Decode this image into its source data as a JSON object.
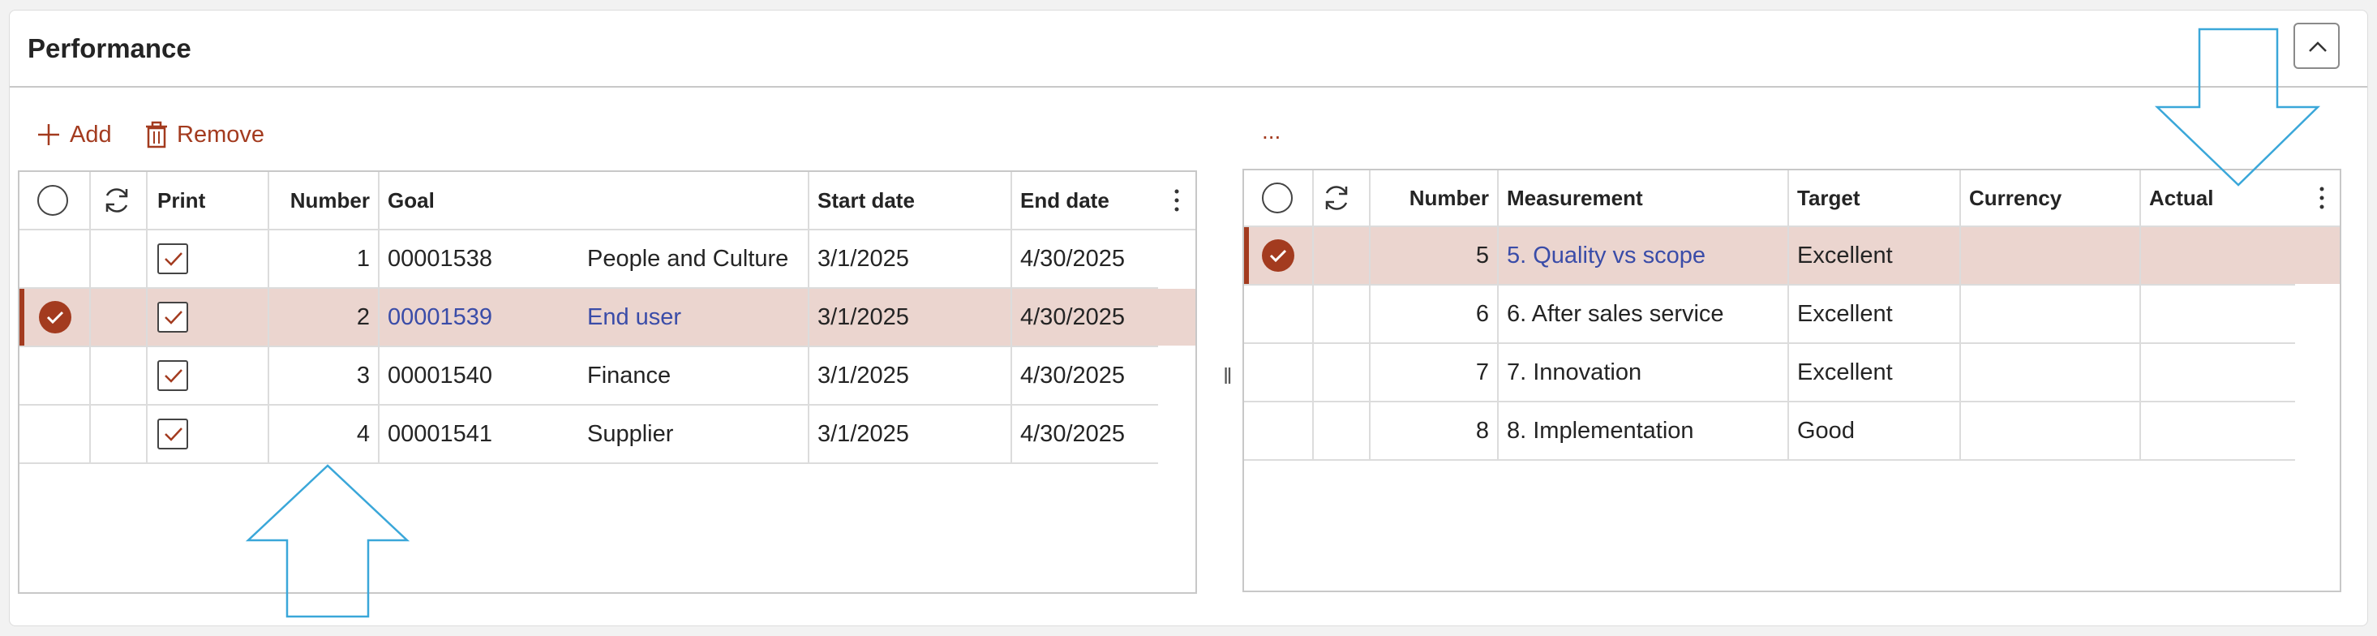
{
  "panel": {
    "title": "Performance"
  },
  "toolbar": {
    "add_label": "Add",
    "remove_label": "Remove",
    "more_label": "..."
  },
  "goals": {
    "headers": {
      "print": "Print",
      "number": "Number",
      "goal": "Goal",
      "start": "Start date",
      "end": "End date"
    },
    "rows": [
      {
        "number": "1",
        "goal_id": "00001538",
        "goal_name": "People and Culture",
        "start": "3/1/2025",
        "end": "4/30/2025",
        "print": true,
        "selected": false
      },
      {
        "number": "2",
        "goal_id": "00001539",
        "goal_name": "End user",
        "start": "3/1/2025",
        "end": "4/30/2025",
        "print": true,
        "selected": true
      },
      {
        "number": "3",
        "goal_id": "00001540",
        "goal_name": "Finance",
        "start": "3/1/2025",
        "end": "4/30/2025",
        "print": true,
        "selected": false
      },
      {
        "number": "4",
        "goal_id": "00001541",
        "goal_name": "Supplier",
        "start": "3/1/2025",
        "end": "4/30/2025",
        "print": true,
        "selected": false
      }
    ]
  },
  "measurements": {
    "headers": {
      "number": "Number",
      "measurement": "Measurement",
      "target": "Target",
      "currency": "Currency",
      "actual": "Actual"
    },
    "rows": [
      {
        "number": "5",
        "measurement": "5. Quality vs scope",
        "target": "Excellent",
        "currency": "",
        "actual": "",
        "selected": true
      },
      {
        "number": "6",
        "measurement": "6. After sales service",
        "target": "Excellent",
        "currency": "",
        "actual": "",
        "selected": false
      },
      {
        "number": "7",
        "measurement": "7. Innovation",
        "target": "Excellent",
        "currency": "",
        "actual": "",
        "selected": false
      },
      {
        "number": "8",
        "measurement": "8. Implementation",
        "target": "Good",
        "currency": "",
        "actual": "",
        "selected": false
      }
    ]
  },
  "colors": {
    "accent": "#a33b1f",
    "selected_row": "#ebd5cf",
    "link": "#3a4ca8",
    "arrow": "#3aa7d9"
  },
  "icons": {
    "add": "plus-icon",
    "remove": "trash-icon",
    "collapse": "chevron-up-icon",
    "refresh": "refresh-icon",
    "more": "more-vertical-icon"
  }
}
